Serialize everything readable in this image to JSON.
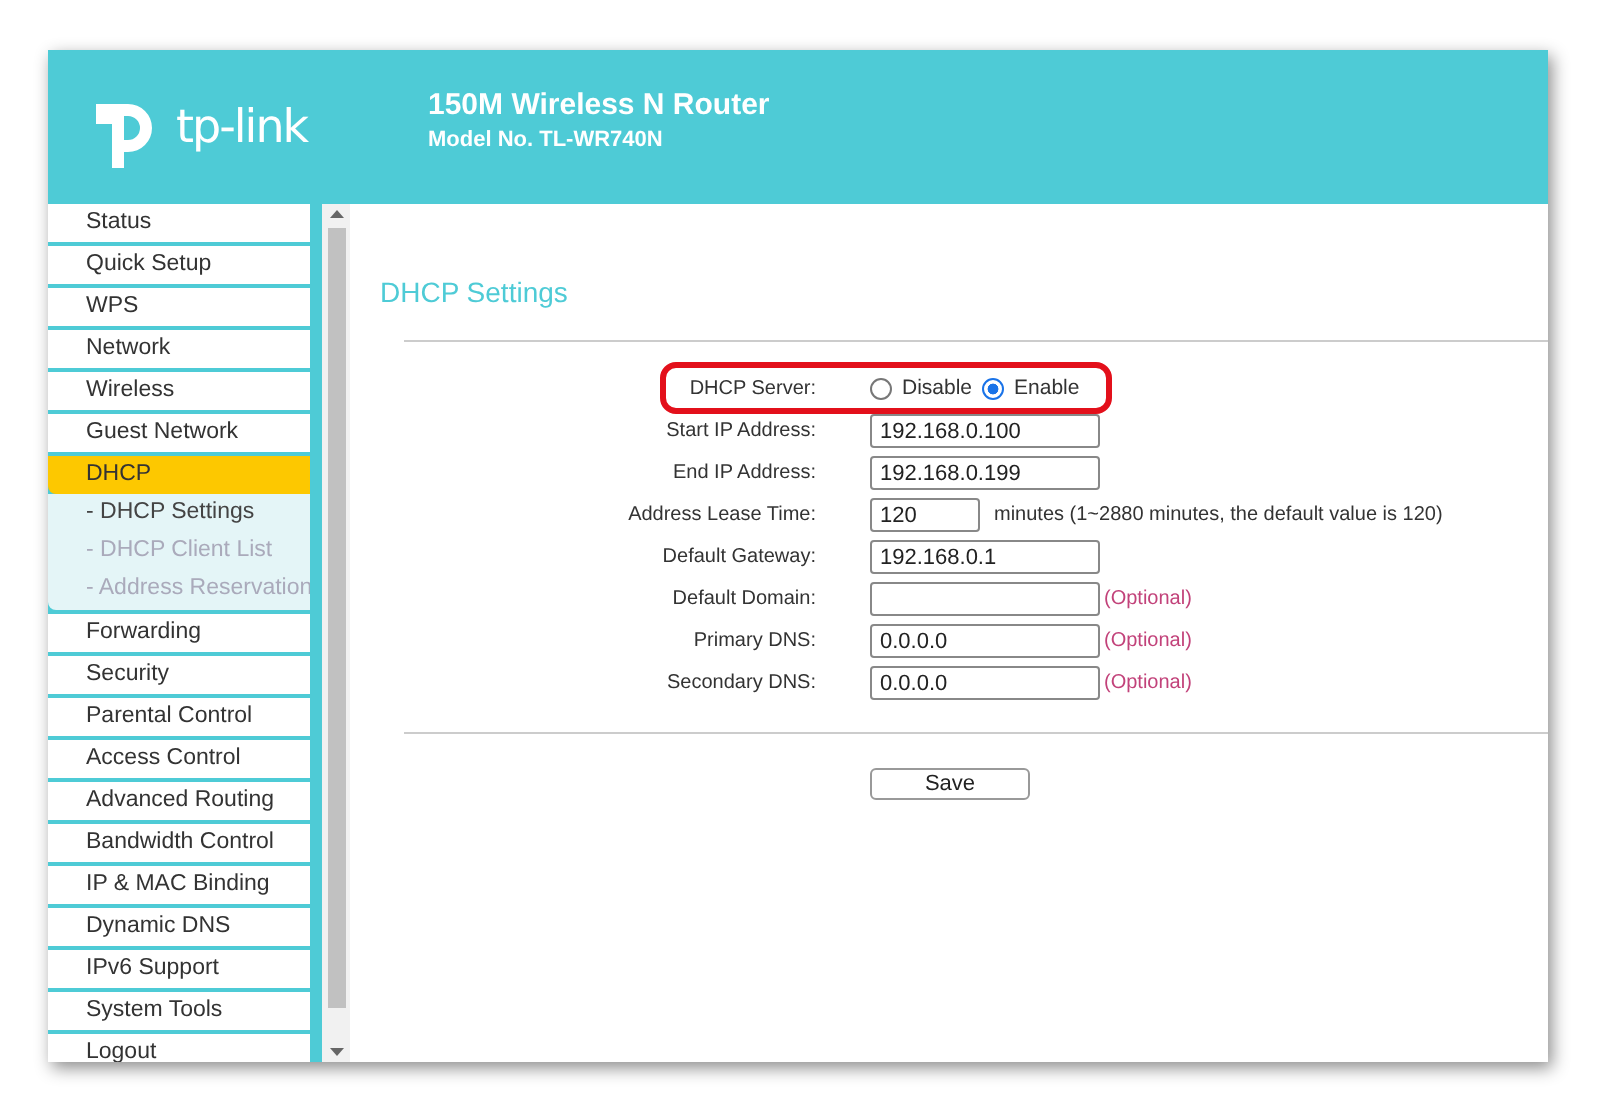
{
  "header": {
    "logo_text": "tp-link",
    "title": "150M Wireless N Router",
    "model": "Model No. TL-WR740N"
  },
  "sidebar": {
    "items": [
      {
        "label": "Status",
        "selected": false
      },
      {
        "label": "Quick Setup",
        "selected": false
      },
      {
        "label": "WPS",
        "selected": false
      },
      {
        "label": "Network",
        "selected": false
      },
      {
        "label": "Wireless",
        "selected": false
      },
      {
        "label": "Guest Network",
        "selected": false
      },
      {
        "label": "DHCP",
        "selected": true,
        "expanded": true,
        "children": [
          {
            "label": "- DHCP Settings",
            "selected": true
          },
          {
            "label": "- DHCP Client List",
            "selected": false
          },
          {
            "label": "- Address Reservation",
            "selected": false
          }
        ]
      },
      {
        "label": "Forwarding",
        "selected": false
      },
      {
        "label": "Security",
        "selected": false
      },
      {
        "label": "Parental Control",
        "selected": false
      },
      {
        "label": "Access Control",
        "selected": false
      },
      {
        "label": "Advanced Routing",
        "selected": false
      },
      {
        "label": "Bandwidth Control",
        "selected": false
      },
      {
        "label": "IP & MAC Binding",
        "selected": false
      },
      {
        "label": "Dynamic DNS",
        "selected": false
      },
      {
        "label": "IPv6 Support",
        "selected": false
      },
      {
        "label": "System Tools",
        "selected": false
      },
      {
        "label": "Logout",
        "selected": false
      }
    ]
  },
  "content": {
    "title": "DHCP Settings",
    "rows": [
      {
        "kind": "radio",
        "label": "DHCP Server:",
        "highlighted": true,
        "options": [
          {
            "label": "Disable",
            "selected": false
          },
          {
            "label": "Enable",
            "selected": true
          }
        ]
      },
      {
        "kind": "text",
        "label": "Start IP Address:",
        "value": "192.168.0.100"
      },
      {
        "kind": "text",
        "label": "End IP Address:",
        "value": "192.168.0.199"
      },
      {
        "kind": "short",
        "label": "Address Lease Time:",
        "value": "120",
        "note": "minutes (1~2880 minutes, the default value is 120)"
      },
      {
        "kind": "text",
        "label": "Default Gateway:",
        "value": "192.168.0.1"
      },
      {
        "kind": "text",
        "label": "Default Domain:",
        "optional": "(Optional)"
      },
      {
        "kind": "text",
        "label": "Primary DNS:",
        "value": "0.0.0.0",
        "optional": "(Optional)"
      },
      {
        "kind": "text",
        "label": "Secondary DNS:",
        "value": "0.0.0.0",
        "optional": "(Optional)"
      }
    ],
    "save_button": "Save"
  }
}
